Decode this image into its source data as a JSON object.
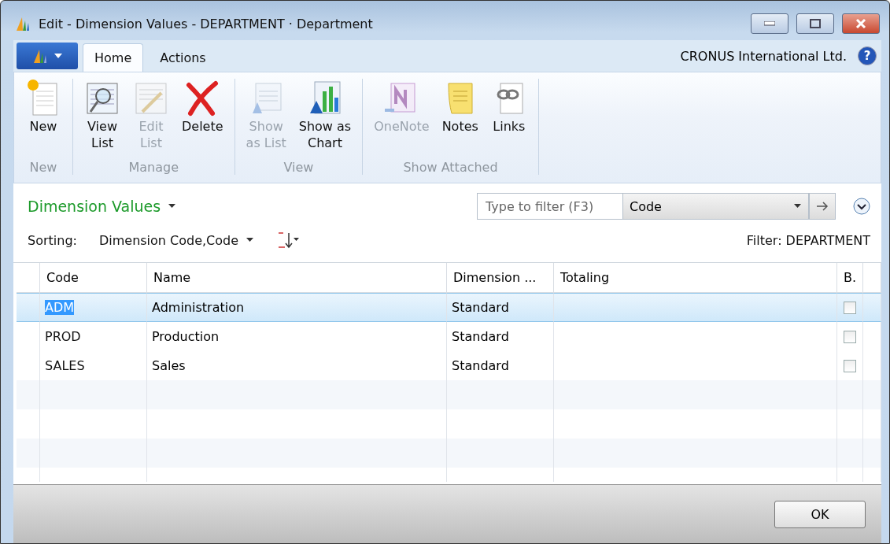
{
  "window": {
    "title": "Edit - Dimension Values - DEPARTMENT · Department"
  },
  "ribbon": {
    "tabs": [
      {
        "label": "Home",
        "selected": true
      },
      {
        "label": "Actions",
        "selected": false
      }
    ],
    "company": "CRONUS International Ltd.",
    "help": "?",
    "groups": [
      {
        "label": "New",
        "actions": [
          {
            "label": "New",
            "kind": "new",
            "disabled": false
          }
        ]
      },
      {
        "label": "Manage",
        "actions": [
          {
            "label": "View\nList",
            "kind": "view",
            "disabled": false
          },
          {
            "label": "Edit\nList",
            "kind": "edit",
            "disabled": true
          },
          {
            "label": "Delete",
            "kind": "delete",
            "disabled": false
          }
        ]
      },
      {
        "label": "View",
        "actions": [
          {
            "label": "Show\nas List",
            "kind": "list",
            "disabled": true
          },
          {
            "label": "Show as\nChart",
            "kind": "chart",
            "disabled": false
          }
        ]
      },
      {
        "label": "Show Attached",
        "actions": [
          {
            "label": "OneNote",
            "kind": "onenote",
            "disabled": true
          },
          {
            "label": "Notes",
            "kind": "notes",
            "disabled": false
          },
          {
            "label": "Links",
            "kind": "links",
            "disabled": false
          }
        ]
      }
    ]
  },
  "page": {
    "title": "Dimension Values",
    "filter": {
      "placeholder": "Type to filter (F3)",
      "field": "Code"
    },
    "sorting_label": "Sorting:",
    "sorting": "Dimension Code,Code",
    "filter_text": "Filter: DEPARTMENT"
  },
  "table": {
    "columns": [
      "Code",
      "Name",
      "Dimension ...",
      "Totaling",
      "B."
    ],
    "rows": [
      {
        "code": "ADM",
        "name": "Administration",
        "dimension_type": "Standard",
        "blocked": false,
        "selected": true
      },
      {
        "code": "PROD",
        "name": "Production",
        "dimension_type": "Standard",
        "blocked": false,
        "selected": false
      },
      {
        "code": "SALES",
        "name": "Sales",
        "dimension_type": "Standard",
        "blocked": false,
        "selected": false
      }
    ]
  },
  "buttons": [
    {
      "label": "OK"
    }
  ]
}
